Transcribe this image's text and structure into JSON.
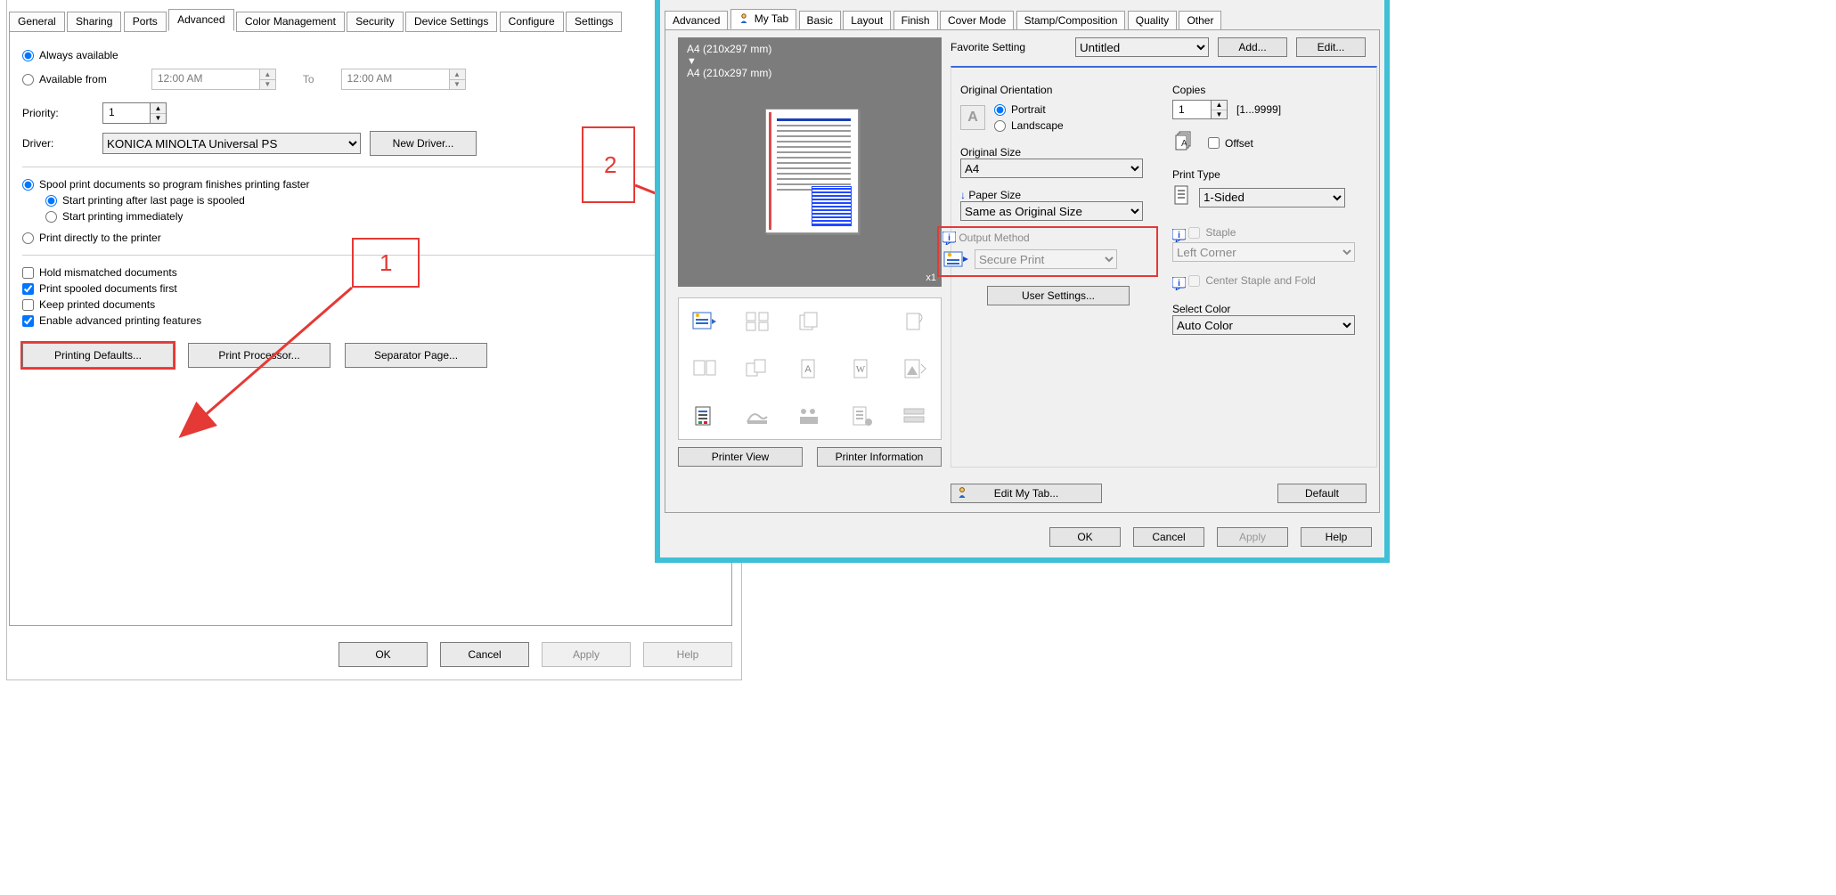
{
  "left": {
    "tabs": [
      "General",
      "Sharing",
      "Ports",
      "Advanced",
      "Color Management",
      "Security",
      "Device Settings",
      "Configure",
      "Settings"
    ],
    "activeTab": 3,
    "alwaysAvailable": "Always available",
    "availableFrom": "Available from",
    "timeFromVal": "12:00 AM",
    "toLabel": "To",
    "timeToVal": "12:00 AM",
    "priorityLabel": "Priority:",
    "priorityVal": "1",
    "driverLabel": "Driver:",
    "driverVal": "KONICA MINOLTA Universal PS",
    "newDriverBtn": "New Driver...",
    "spoolOpt": "Spool print documents so program finishes printing faster",
    "spoolSub1": "Start printing after last page is spooled",
    "spoolSub2": "Start printing immediately",
    "directOpt": "Print directly to the printer",
    "holdMismatch": "Hold mismatched documents",
    "printSpooledFirst": "Print spooled documents first",
    "keepPrinted": "Keep printed documents",
    "enableAdv": "Enable advanced printing features",
    "printingDefaultsBtn": "Printing Defaults...",
    "printProcessorBtn": "Print Processor...",
    "separatorPageBtn": "Separator Page...",
    "ok": "OK",
    "cancel": "Cancel",
    "apply": "Apply",
    "help": "Help",
    "callout1": "1"
  },
  "right": {
    "tabs": [
      "Advanced",
      "My Tab",
      "Basic",
      "Layout",
      "Finish",
      "Cover Mode",
      "Stamp/Composition",
      "Quality",
      "Other"
    ],
    "activeTab": 1,
    "favLabel": "Favorite Setting",
    "favVal": "Untitled",
    "addBtn": "Add...",
    "editBtn": "Edit...",
    "previewFrom": "A4  (210x297 mm)",
    "previewTo": "A4  (210x297 mm)",
    "printerView": "Printer View",
    "printerInfo": "Printer Information",
    "editMyTab": "    Edit My Tab...",
    "defaultBtn": "Default",
    "orientationTitle": "Original Orientation",
    "portrait": "Portrait",
    "landscape": "Landscape",
    "origSizeTitle": "Original Size",
    "origSizeVal": "A4",
    "paperSizeTitle": "Paper Size",
    "paperSizeVal": "Same as Original Size",
    "outputTitle": "Output Method",
    "outputVal": "Secure Print",
    "userSettingsBtn": "User Settings...",
    "copiesTitle": "Copies",
    "copiesVal": "1",
    "copiesRange": "[1...9999]",
    "offset": "Offset",
    "printTypeTitle": "Print Type",
    "printTypeVal": "1-Sided",
    "stapleTitle": "Staple",
    "stapleVal": "Left Corner",
    "centerStaple": "Center Staple and Fold",
    "selectColorTitle": "Select Color",
    "selectColorVal": "Auto Color",
    "ok": "OK",
    "cancel": "Cancel",
    "apply": "Apply",
    "help": "Help",
    "callout2": "2"
  }
}
